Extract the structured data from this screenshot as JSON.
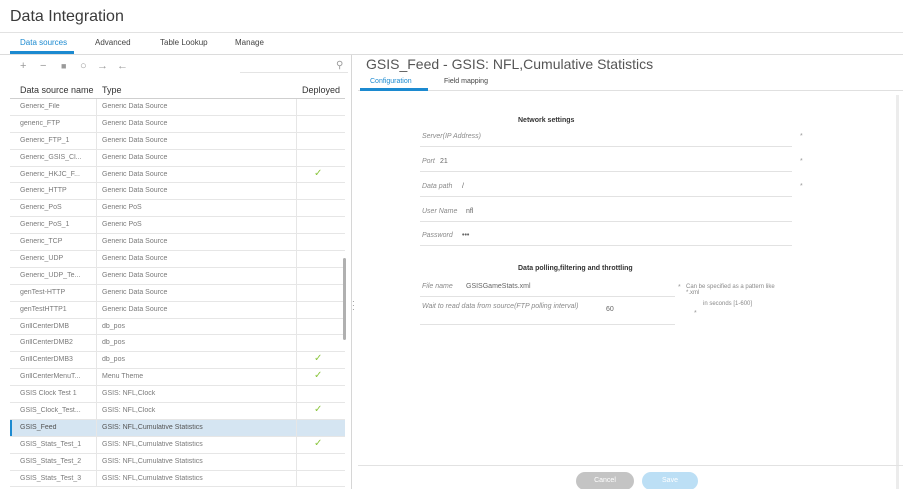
{
  "app": {
    "title": "Data Integration"
  },
  "main_tabs": [
    "Data sources",
    "Advanced",
    "Table Lookup",
    "Manage"
  ],
  "toolbar": {
    "icons": [
      "plus-icon",
      "minus-icon",
      "copy-icon",
      "refresh-icon",
      "arrow-right-icon",
      "arrow-left-icon",
      "search-icon"
    ]
  },
  "table": {
    "headers": [
      "Data source name",
      "Type",
      "Deployed"
    ],
    "rows": [
      {
        "name": "Generic_File",
        "type": "Generic Data Source",
        "deployed": false
      },
      {
        "name": "generic_FTP",
        "type": "Generic Data Source",
        "deployed": false
      },
      {
        "name": "Generic_FTP_1",
        "type": "Generic Data Source",
        "deployed": false
      },
      {
        "name": "Generic_GSIS_Cl...",
        "type": "Generic Data Source",
        "deployed": false
      },
      {
        "name": "Generic_HKJC_F...",
        "type": "Generic Data Source",
        "deployed": true
      },
      {
        "name": "Generic_HTTP",
        "type": "Generic Data Source",
        "deployed": false
      },
      {
        "name": "Generic_PoS",
        "type": "Generic PoS",
        "deployed": false
      },
      {
        "name": "Generic_PoS_1",
        "type": "Generic PoS",
        "deployed": false
      },
      {
        "name": "Generic_TCP",
        "type": "Generic Data Source",
        "deployed": false
      },
      {
        "name": "Generic_UDP",
        "type": "Generic Data Source",
        "deployed": false
      },
      {
        "name": "Generic_UDP_Te...",
        "type": "Generic Data Source",
        "deployed": false
      },
      {
        "name": "genTest-HTTP",
        "type": "Generic Data Source",
        "deployed": false
      },
      {
        "name": "genTestHTTP1",
        "type": "Generic Data Source",
        "deployed": false
      },
      {
        "name": "GrillCenterDMB",
        "type": "db_pos",
        "deployed": false
      },
      {
        "name": "GrillCenterDMB2",
        "type": "db_pos",
        "deployed": false
      },
      {
        "name": "GrillCenterDMB3",
        "type": "db_pos",
        "deployed": true
      },
      {
        "name": "GrillCenterMenuT...",
        "type": "Menu Theme",
        "deployed": true
      },
      {
        "name": "GSIS Clock Test 1",
        "type": "GSIS: NFL,Clock",
        "deployed": false
      },
      {
        "name": "GSIS_Clock_Test...",
        "type": "GSIS: NFL,Clock",
        "deployed": true
      },
      {
        "name": "GSIS_Feed",
        "type": "GSIS: NFL,Cumulative Statistics",
        "deployed": false,
        "selected": true
      },
      {
        "name": "GSIS_Stats_Test_1",
        "type": "GSIS: NFL,Cumulative Statistics",
        "deployed": true
      },
      {
        "name": "GSIS_Stats_Test_2",
        "type": "GSIS: NFL,Cumulative Statistics",
        "deployed": false
      },
      {
        "name": "GSIS_Stats_Test_3",
        "type": "GSIS: NFL,Cumulative Statistics",
        "deployed": false
      }
    ]
  },
  "detail": {
    "title": "GSIS_Feed - GSIS: NFL,Cumulative Statistics",
    "tabs": [
      "Configuration",
      "Field mapping"
    ],
    "network": {
      "section_title": "Network settings",
      "server_label": "Server(IP Address)",
      "server_value": "",
      "port_label": "Port",
      "port_value": "21",
      "path_label": "Data path",
      "path_value": "/",
      "user_label": "User Name",
      "user_value": "nfl",
      "password_label": "Password",
      "password_value": "•••"
    },
    "polling": {
      "section_title": "Data polling,filtering and throttling",
      "filename_label": "File name",
      "filename_value": "GSISGameStats.xml",
      "filename_hint": "Can be specified as a pattern like *.xml",
      "wait_label": "Wait to read data from source(FTP polling interval)",
      "wait_value": "60",
      "wait_hint": "in seconds [1-600]"
    },
    "buttons": {
      "cancel": "Cancel",
      "save": "Save"
    }
  },
  "colors": {
    "accent": "#1c8ad0",
    "check": "#8cc63f",
    "selected_row": "#d5e5f2"
  }
}
